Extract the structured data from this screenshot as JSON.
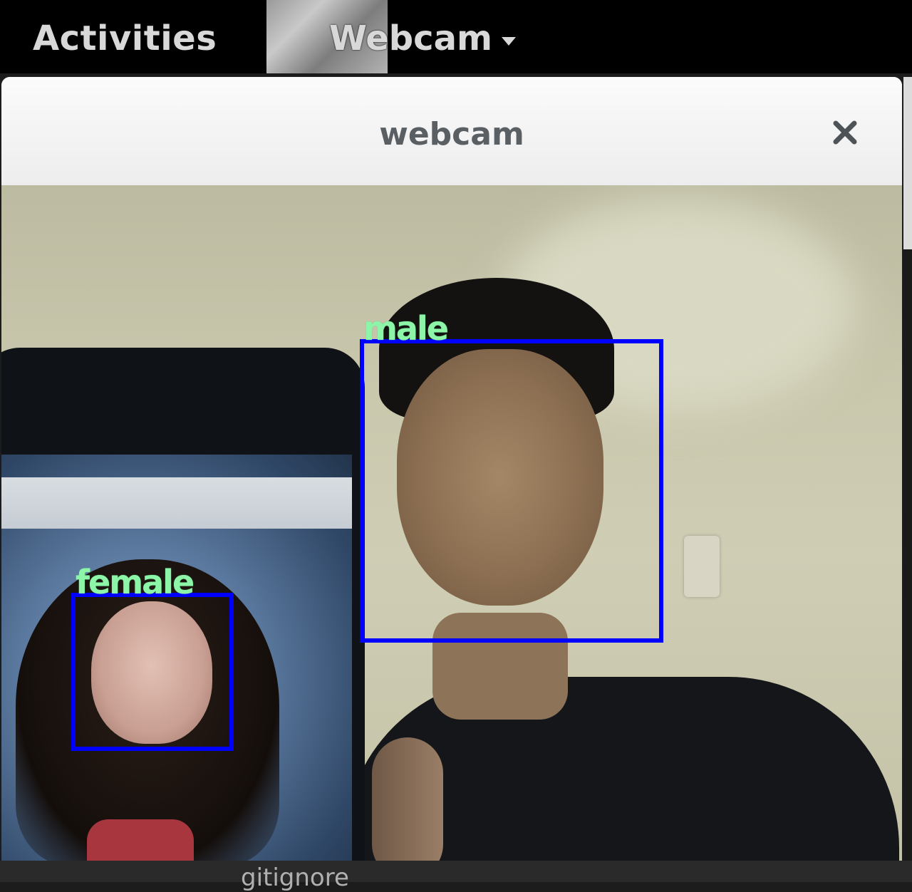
{
  "top_bar": {
    "activities_label": "Activities",
    "app_menu_label": "Webcam",
    "app_menu_arrow_icon": "triangle-down-icon"
  },
  "window": {
    "title": "webcam",
    "close_icon": "close-icon"
  },
  "detections": [
    {
      "label": "male"
    },
    {
      "label": "female"
    }
  ],
  "colors": {
    "box": "#0000ff",
    "label": "#8cf5a8"
  },
  "bottom_text": "gitignore"
}
